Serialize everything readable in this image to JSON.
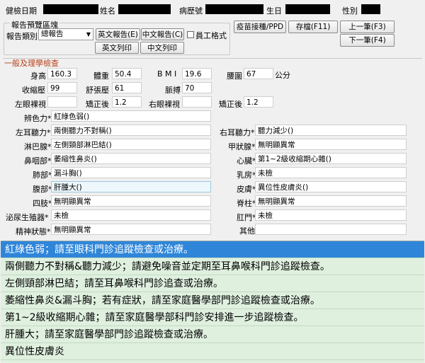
{
  "header": {
    "exam_date_label": "健檢日期",
    "name_label": "姓名",
    "record_no_label": "病歷號",
    "birthday_label": "生日",
    "gender_label": "性別"
  },
  "report": {
    "group_title": "報告預覽區塊",
    "type_label": "報告類別",
    "type_value": "總報告",
    "btn_en_report": "英文報告(E)",
    "btn_zh_report": "中文報告(C)",
    "employee_format_label": "員工格式",
    "btn_en_print": "英文列印",
    "btn_zh_print": "中文列印"
  },
  "actions": {
    "vaccine": "疫苗接種/PPD",
    "save": "存檔(F11)",
    "prev": "上一筆(F3)",
    "next": "下一筆(F4)"
  },
  "section_title": "一般及理學檢查",
  "vitals": {
    "height_label": "身高",
    "height": "160.3",
    "weight_label": "體重",
    "weight": "50.4",
    "bmi_label": "B M I",
    "bmi": "19.6",
    "waist_label": "腰圍",
    "waist": "67",
    "waist_unit": "公分",
    "systolic_label": "收縮壓",
    "systolic": "99",
    "diastolic_label": "舒張壓",
    "diastolic": "61",
    "pulse_label": "脈搏",
    "pulse": "70"
  },
  "vision": {
    "left_bare_label": "左眼裸視",
    "left_bare": "",
    "left_corr_label": "矯正後",
    "left_corr": "1.2",
    "right_bare_label": "右眼裸視",
    "right_bare": "",
    "right_corr_label": "矯正後",
    "right_corr": "1.2"
  },
  "exam": {
    "color_label": "辨色力*",
    "color": "紅綠色弱()",
    "left_ear_label": "左耳聽力*",
    "left_ear": "兩側聽力不對稱()",
    "right_ear_label": "右耳聽力*",
    "right_ear": "聽力減少()",
    "lymph_label": "淋巴腺*",
    "lymph": "左側頸部淋巴結()",
    "thyroid_label": "甲狀腺*",
    "thyroid": "無明顯異常",
    "nose_label": "鼻咽部*",
    "nose": "萎縮性鼻炎()",
    "heart_label": "心臟*",
    "heart": "第1~2級收縮期心雜()",
    "lung_label": "肺部*",
    "lung": "漏斗胸()",
    "breast_label": "乳房*",
    "breast": "未檢",
    "abdomen_label": "腹部*",
    "abdomen": "肝腫大()",
    "skin_label": "皮膚*",
    "skin": "異位性皮膚炎()",
    "limbs_label": "四肢*",
    "limbs": "無明顯異常",
    "spine_label": "脊柱*",
    "spine": "無明顯異常",
    "urogenital_label": "泌尿生殖器*",
    "urogenital": "未檢",
    "anus_label": "肛門*",
    "anus": "未檢",
    "mental_label": "精神狀態*",
    "mental": "無明顯異常",
    "other_label": "其他",
    "other": ""
  },
  "findings": [
    "紅綠色弱；請至眼科門診追蹤檢查或治療。",
    "兩側聽力不對稱&聽力減少；請避免噪音並定期至耳鼻喉科門診追蹤檢查。",
    "左側頸部淋巴結；請至耳鼻喉科門診追查或治療。",
    "萎縮性鼻炎&漏斗胸；若有症狀，請至家庭醫學部門診追蹤檢查或治療。",
    "第1~2級收縮期心雜；請至家庭醫學部科門診安排進一步追蹤檢查。",
    "肝腫大；請至家庭醫學部門診追蹤檢查或治療。",
    "異位性皮膚炎"
  ],
  "colors": {
    "selected_row": "#2f86d9",
    "list_bg": "#dff0df",
    "section_title": "#b8401c"
  }
}
